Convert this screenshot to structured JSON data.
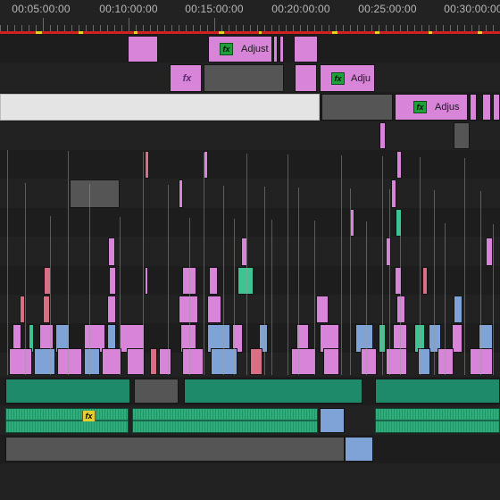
{
  "app": {
    "name": "Video editor timeline"
  },
  "ruler": {
    "timecodes": [
      "00:05:00:00",
      "00:10:00:00",
      "00:15:00:00",
      "00:20:00:00",
      "00:25:00:00",
      "00:30:00:00"
    ]
  },
  "clips": {
    "adjust_1_label": "Adjust",
    "adjust_2_label": "Adju",
    "adjust_3_label": "Adjus",
    "fx_label": "fx"
  },
  "colors": {
    "adjustment_layer": "#d884d8",
    "video_red": "#d96f85",
    "video_blue": "#7fa3d6",
    "video_green": "#3cc493",
    "audio": "#2fae7c",
    "work_area": "#d21f1f",
    "fx_badge": "#1fa03a",
    "fx_badge_yellow": "#e6cf2a"
  }
}
